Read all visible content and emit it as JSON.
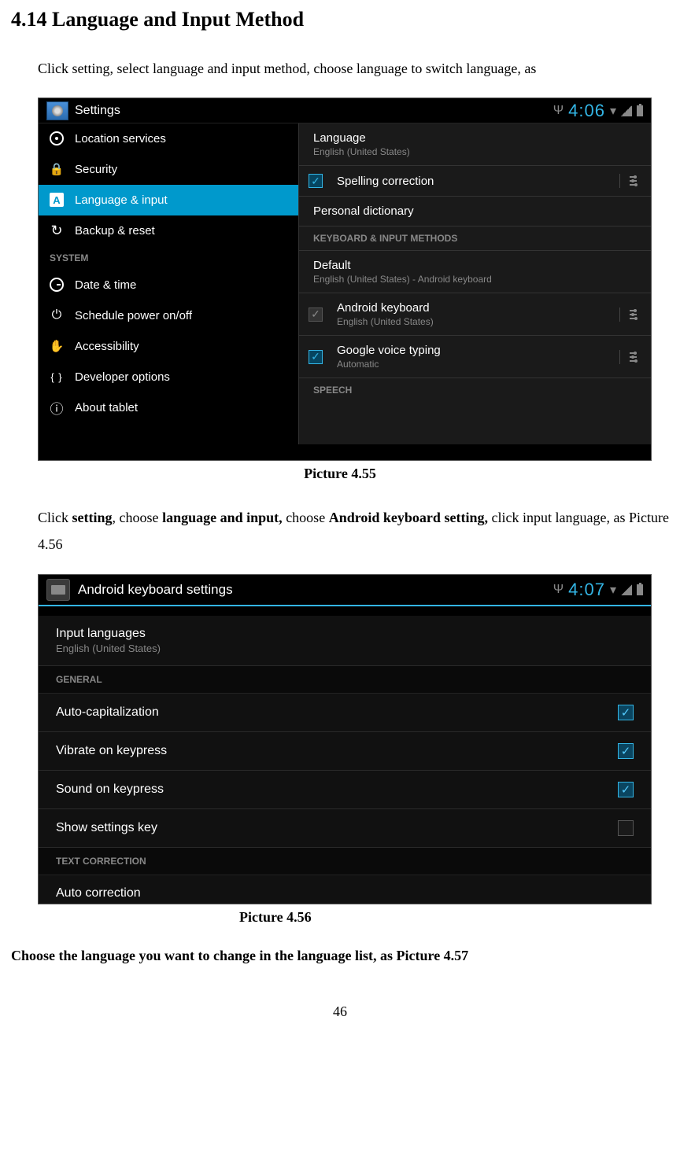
{
  "heading": "4.14  Language and Input Method",
  "para1": "Click setting, select language and input method, choose language to switch language, as",
  "caption1": "Picture 4.55",
  "para2_parts": {
    "p1": "Click ",
    "b1": "setting",
    "p2": ", choose ",
    "b2": "language and input,",
    "p3": " choose ",
    "b3": "Android keyboard setting,",
    "p4": " click input language, as Picture 4.56"
  },
  "caption2": "Picture 4.56",
  "footer": "Choose the language you want to change in the language list, as Picture 4.57",
  "page_number": "46",
  "s1": {
    "app_title": "Settings",
    "clock": "4:06",
    "sidebar": {
      "items": [
        {
          "label": "Location services"
        },
        {
          "label": "Security"
        },
        {
          "label": "Language & input"
        },
        {
          "label": "Backup & reset"
        }
      ],
      "section": "SYSTEM",
      "items2": [
        {
          "label": "Date & time"
        },
        {
          "label": "Schedule power on/off"
        },
        {
          "label": "Accessibility"
        },
        {
          "label": "Developer options"
        },
        {
          "label": "About tablet"
        }
      ]
    },
    "main": {
      "lang_title": "Language",
      "lang_sub": "English (United States)",
      "spell": "Spelling correction",
      "pdict": "Personal dictionary",
      "kb_hdr": "KEYBOARD & INPUT METHODS",
      "def_title": "Default",
      "def_sub": "English (United States) - Android keyboard",
      "akb_title": "Android keyboard",
      "akb_sub": "English (United States)",
      "gvt_title": "Google voice typing",
      "gvt_sub": "Automatic",
      "speech_hdr": "SPEECH"
    }
  },
  "s2": {
    "app_title": "Android keyboard settings",
    "clock": "4:07",
    "rows": {
      "il_title": "Input languages",
      "il_sub": "English (United States)",
      "hdr1": "GENERAL",
      "r1": "Auto-capitalization",
      "r2": "Vibrate on keypress",
      "r3": "Sound on keypress",
      "r4": "Show settings key",
      "hdr2": "TEXT CORRECTION",
      "r5": "Auto correction"
    }
  }
}
